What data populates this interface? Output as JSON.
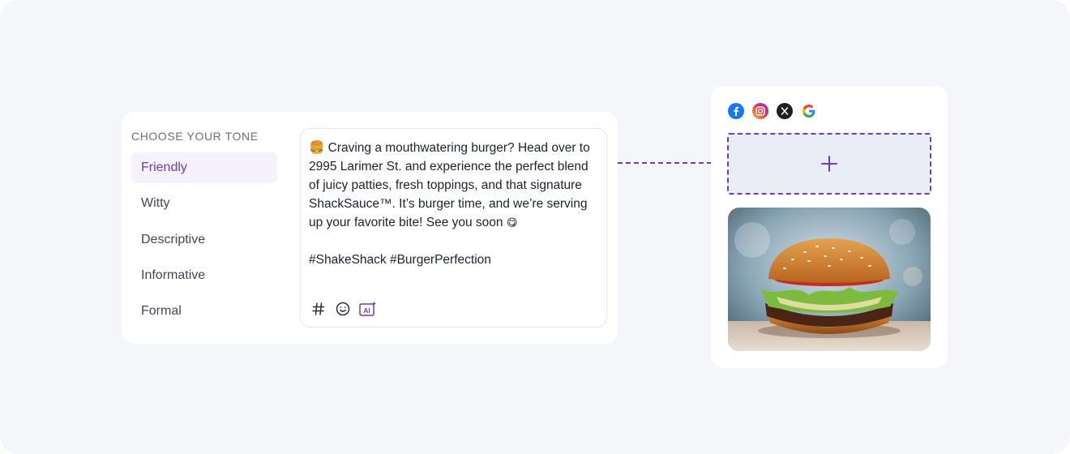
{
  "composer": {
    "tone_heading": "Choose your tone",
    "tones": [
      {
        "label": "Friendly",
        "active": true
      },
      {
        "label": "Witty",
        "active": false
      },
      {
        "label": "Descriptive",
        "active": false
      },
      {
        "label": "Informative",
        "active": false
      },
      {
        "label": "Formal",
        "active": false
      }
    ],
    "post": {
      "leading_emoji": "🍔",
      "body": "Craving a mouthwatering burger? Head over to 2995 Larimer St. and experience the perfect blend of juicy patties, fresh toppings, and that signature ShackSauce™. It’s burger time, and we’re serving up your favorite bite! See you soon",
      "trailing_emoji": "😋",
      "hashtags": "#ShakeShack #BurgerPerfection"
    },
    "tools": [
      {
        "name": "hashtag-icon"
      },
      {
        "name": "emoji-icon"
      },
      {
        "name": "ai-assist-icon",
        "label": "AI"
      }
    ]
  },
  "preview": {
    "socials": [
      "facebook-icon",
      "instagram-icon",
      "x-icon",
      "google-icon"
    ],
    "add_media_icon": "plus-icon",
    "image": "burger-photo"
  },
  "colors": {
    "accent": "#6a3cc4",
    "active_bg": "#f5f2fd",
    "page_bg": "#f5f6fa",
    "facebook": "#1877f2",
    "x": "#1f1f1f"
  }
}
